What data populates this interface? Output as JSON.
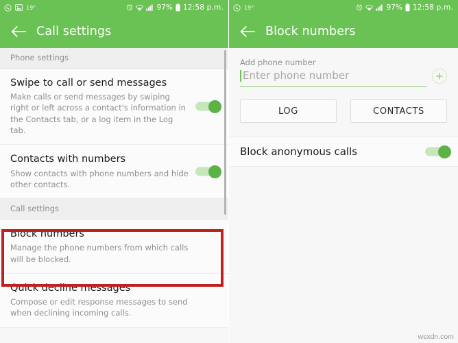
{
  "statusbar": {
    "whatsapp_icon": "whatsapp-icon",
    "screenshot_icon": "image-icon",
    "temperature": "19°",
    "alarm_icon": "alarm-icon",
    "wifi_icon": "wifi-icon",
    "signal_icon": "signal-icon",
    "battery_percent": "97%",
    "battery_icon": "battery-icon",
    "time": "12:58 p.m."
  },
  "left_panel": {
    "appbar": {
      "back_icon": "back-arrow-icon",
      "title": "Call settings"
    },
    "sections": [
      {
        "header": "Phone settings",
        "items": [
          {
            "title": "Swipe to call or send messages",
            "subtitle": "Make calls or send messages by swiping right or left across a contact's information in the Contacts tab, or a log item in the Log tab.",
            "toggle": "on"
          },
          {
            "title": "Contacts with numbers",
            "subtitle": "Show contacts with phone numbers and hide other contacts.",
            "toggle": "on"
          }
        ]
      },
      {
        "header": "Call settings",
        "items": [
          {
            "title": "Block numbers",
            "subtitle": "Manage the phone numbers from which calls will be blocked.",
            "toggle": "none",
            "highlighted": true
          },
          {
            "title": "Quick decline messages",
            "subtitle": "Compose or edit response messages to send when declining incoming calls.",
            "toggle": "none"
          }
        ]
      }
    ]
  },
  "right_panel": {
    "appbar": {
      "back_icon": "back-arrow-icon",
      "title": "Block numbers"
    },
    "add_number": {
      "label": "Add phone number",
      "placeholder": "Enter phone number",
      "value": "",
      "add_icon": "plus-icon"
    },
    "buttons": {
      "log": "LOG",
      "contacts": "CONTACTS"
    },
    "anonymous": {
      "title": "Block anonymous calls",
      "toggle": "on"
    }
  },
  "watermark": "wsxdn.com",
  "colors": {
    "accent_green": "#6bc254",
    "toggle_thumb": "#5cb246",
    "toggle_track": "#c5e7ba",
    "highlight_red": "#c0201f",
    "background": "#f7f7f7"
  }
}
